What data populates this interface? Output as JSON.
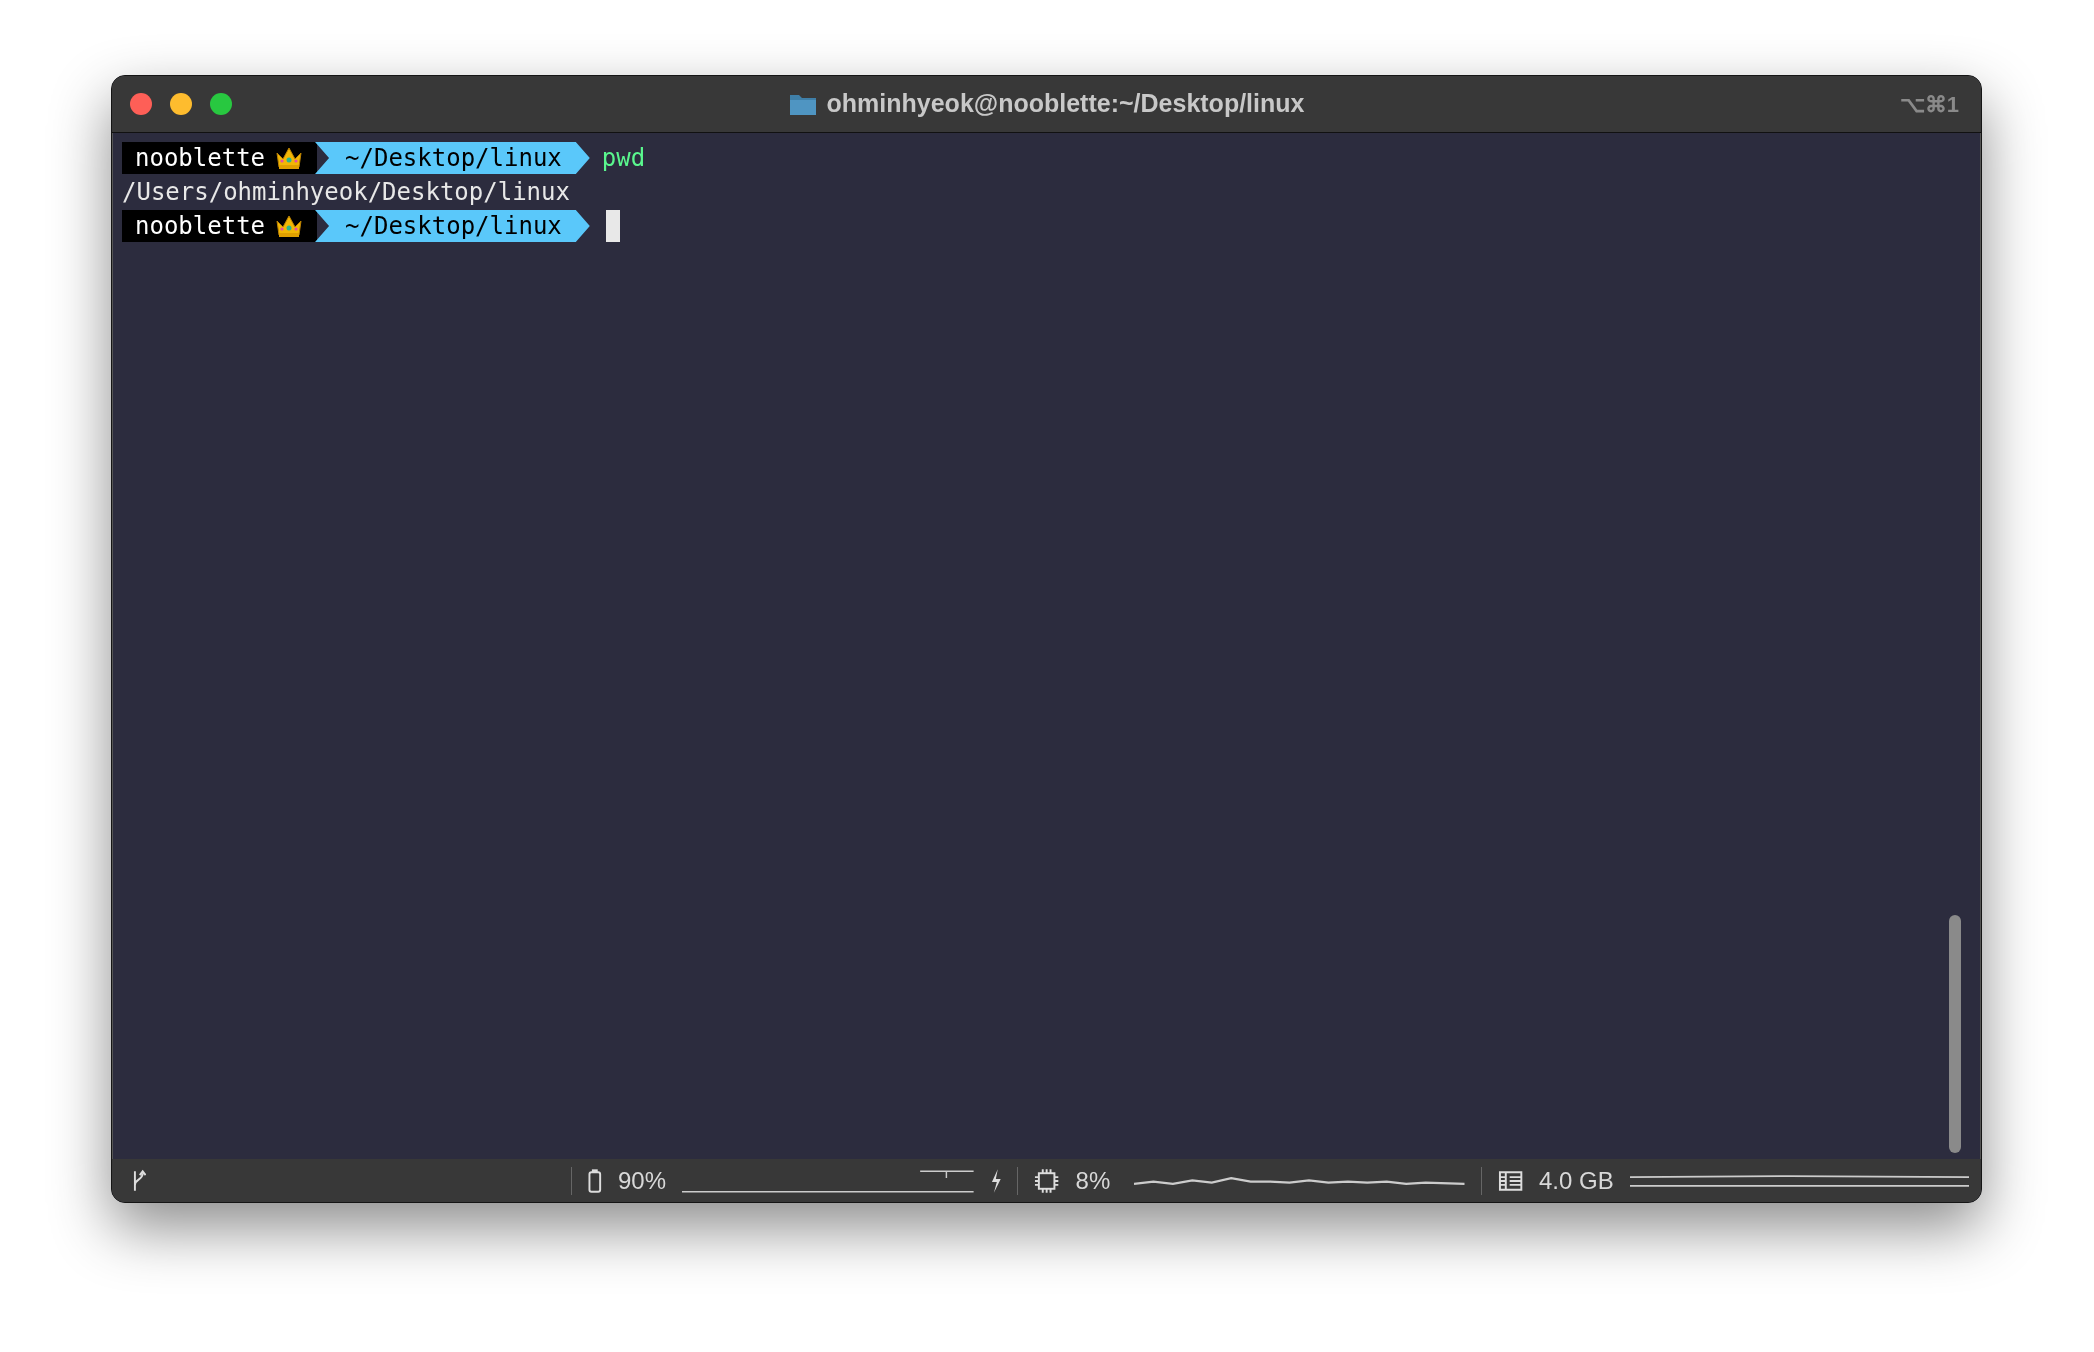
{
  "window": {
    "title": "ohminhyeok@nooblette:~/Desktop/linux",
    "shortcut": "⌥⌘1"
  },
  "terminal": {
    "lines": [
      {
        "kind": "prompt",
        "host": "nooblette",
        "path": "~/Desktop/linux",
        "command": "pwd",
        "cursor": false
      },
      {
        "kind": "output",
        "text": "/Users/ohminhyeok/Desktop/linux"
      },
      {
        "kind": "prompt",
        "host": "nooblette",
        "path": "~/Desktop/linux",
        "cursor": true
      }
    ]
  },
  "status_bar": {
    "battery": "90%",
    "cpu": "8%",
    "memory": "4.0 GB"
  }
}
